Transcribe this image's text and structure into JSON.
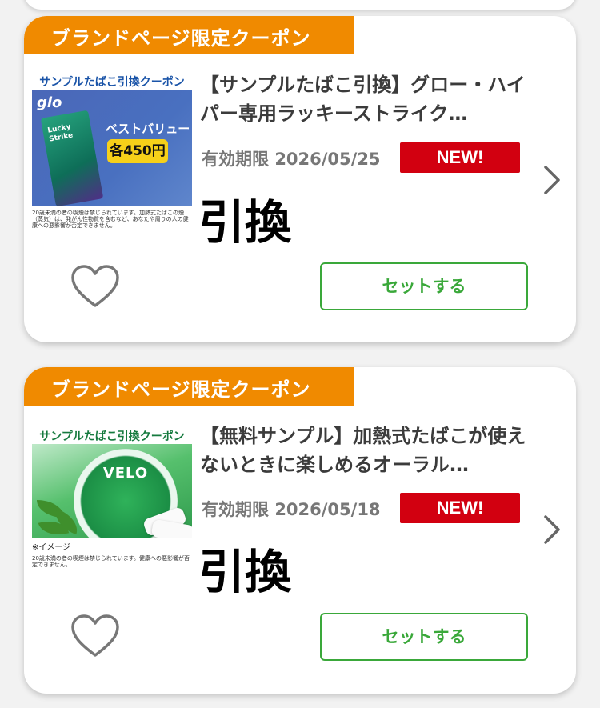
{
  "coupons": [
    {
      "ribbon": "ブランドページ限定クーポン",
      "thumb_label": "サンプルたばこ引換クーポン",
      "thumb_brand": "glo",
      "thumb_tagline": "ベストバリュー",
      "thumb_price": "各450円",
      "thumb_pack_text": "Lucky Strike",
      "thumb_fine_print": "20歳未満の者の喫煙は禁じられています。加熱式たばこの煙（蒸気）は、発がん性物質を含むなど、あなたや周りの人の健康への悪影響が否定できません。",
      "title": "【サンプルたばこ引換】グロー・ハイパー専用ラッキーストライク…",
      "expiry_label": "有効期限",
      "expiry_date": "2026/05/25",
      "badge": "NEW!",
      "big_label": "引換",
      "button_label": "セットする"
    },
    {
      "ribbon": "ブランドページ限定クーポン",
      "thumb_label": "サンプルたばこ引換クーポン",
      "thumb_brand": "VELO",
      "thumb_image_note": "※イメージ",
      "thumb_fine_print": "20歳未満の者の喫煙は禁じられています。健康への悪影響が否定できません。",
      "title": "【無料サンプル】加熱式たばこが使えないときに楽しめるオーラル…",
      "expiry_label": "有効期限",
      "expiry_date": "2026/05/18",
      "badge": "NEW!",
      "big_label": "引換",
      "button_label": "セットする"
    }
  ],
  "colors": {
    "ribbon": "#f08a00",
    "new_badge": "#d20010",
    "button_border": "#3aa83a",
    "background": "#f2f2f2"
  },
  "icons": [
    "heart-icon",
    "chevron-right-icon"
  ]
}
